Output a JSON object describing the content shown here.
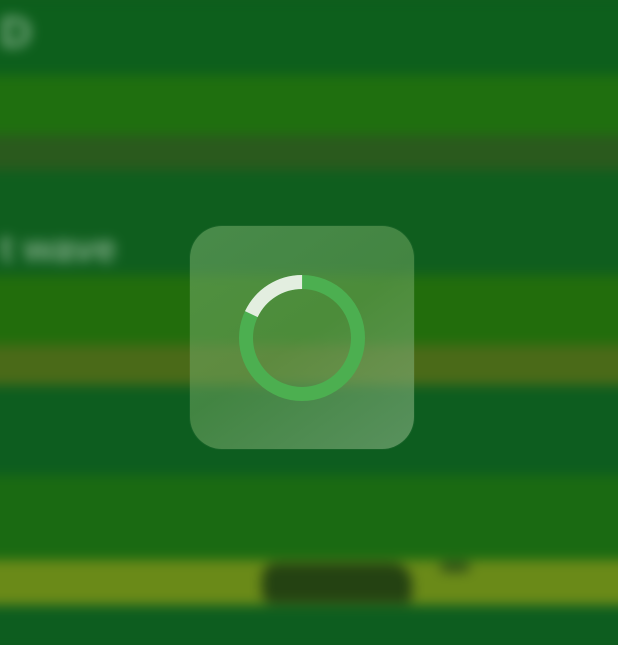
{
  "background": {
    "header_text": "D",
    "row_text": "t wave"
  },
  "loading_hud": {
    "spinner_icon": "loading-spinner-icon",
    "progress": 0.18,
    "colors": {
      "track": "#4caf50",
      "arc": "#e3eee0",
      "panel": "#6aa860"
    }
  }
}
